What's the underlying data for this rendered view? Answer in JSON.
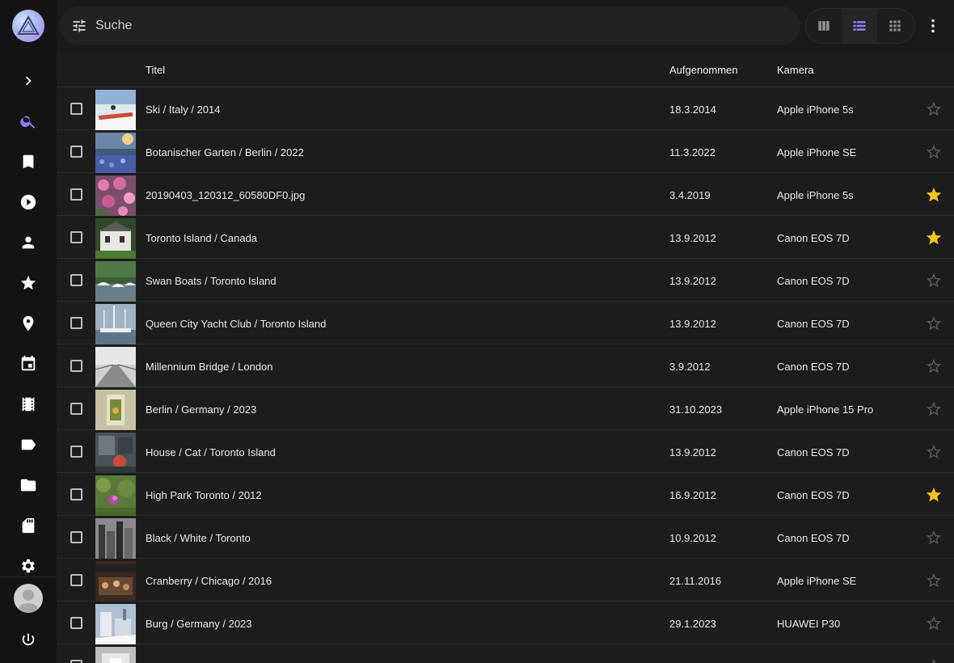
{
  "search": {
    "placeholder": "Suche"
  },
  "sidebar": {
    "items": [
      {
        "icon": "chevron-right-icon"
      },
      {
        "icon": "search-icon",
        "active": true
      },
      {
        "icon": "bookmark-icon"
      },
      {
        "icon": "play-circle-icon"
      },
      {
        "icon": "person-icon"
      },
      {
        "icon": "star-icon"
      },
      {
        "icon": "place-icon"
      },
      {
        "icon": "calendar-icon"
      },
      {
        "icon": "film-icon"
      },
      {
        "icon": "label-icon"
      },
      {
        "icon": "folder-icon"
      },
      {
        "icon": "sd-card-icon"
      },
      {
        "icon": "gear-icon"
      }
    ],
    "footer": [
      {
        "icon": "avatar"
      },
      {
        "icon": "power-icon"
      }
    ]
  },
  "views": [
    {
      "icon": "view-column-icon",
      "active": false
    },
    {
      "icon": "view-list-icon",
      "active": true
    },
    {
      "icon": "view-grid-icon",
      "active": false
    }
  ],
  "table": {
    "headers": {
      "title": "Titel",
      "taken": "Aufgenommen",
      "camera": "Kamera"
    },
    "rows": [
      {
        "title": "Ski / Italy / 2014",
        "date": "18.3.2014",
        "camera": "Apple iPhone 5s",
        "favorite": false,
        "thumb": "ski"
      },
      {
        "title": "Botanischer Garten / Berlin / 2022",
        "date": "11.3.2022",
        "camera": "Apple iPhone SE",
        "favorite": false,
        "thumb": "garden"
      },
      {
        "title": "20190403_120312_60580DF0.jpg",
        "date": "3.4.2019",
        "camera": "Apple iPhone 5s",
        "favorite": true,
        "thumb": "flowers"
      },
      {
        "title": "Toronto Island / Canada",
        "date": "13.9.2012",
        "camera": "Canon EOS 7D",
        "favorite": true,
        "thumb": "house"
      },
      {
        "title": "Swan Boats / Toronto Island",
        "date": "13.9.2012",
        "camera": "Canon EOS 7D",
        "favorite": false,
        "thumb": "boats"
      },
      {
        "title": "Queen City Yacht Club / Toronto Island",
        "date": "13.9.2012",
        "camera": "Canon EOS 7D",
        "favorite": false,
        "thumb": "yacht"
      },
      {
        "title": "Millennium Bridge / London",
        "date": "3.9.2012",
        "camera": "Canon EOS 7D",
        "favorite": false,
        "thumb": "bridge"
      },
      {
        "title": "Berlin / Germany / 2023",
        "date": "31.10.2023",
        "camera": "Apple iPhone 15 Pro",
        "favorite": false,
        "thumb": "berlin"
      },
      {
        "title": "House / Cat / Toronto Island",
        "date": "13.9.2012",
        "camera": "Canon EOS 7D",
        "favorite": false,
        "thumb": "cat"
      },
      {
        "title": "High Park Toronto / 2012",
        "date": "16.9.2012",
        "camera": "Canon EOS 7D",
        "favorite": true,
        "thumb": "park"
      },
      {
        "title": "Black / White / Toronto",
        "date": "10.9.2012",
        "camera": "Canon EOS 7D",
        "favorite": false,
        "thumb": "bw"
      },
      {
        "title": "Cranberry / Chicago / 2016",
        "date": "21.11.2016",
        "camera": "Apple iPhone SE",
        "favorite": false,
        "thumb": "cranberry"
      },
      {
        "title": "Burg / Germany / 2023",
        "date": "29.1.2023",
        "camera": "HUAWEI P30",
        "favorite": false,
        "thumb": "burg"
      },
      {
        "title": "",
        "date": "",
        "camera": "",
        "favorite": false,
        "thumb": "partial"
      }
    ]
  },
  "colors": {
    "accent": "#8f7cf0",
    "star": "#f5c518",
    "star_empty": "#5a5a5a"
  }
}
